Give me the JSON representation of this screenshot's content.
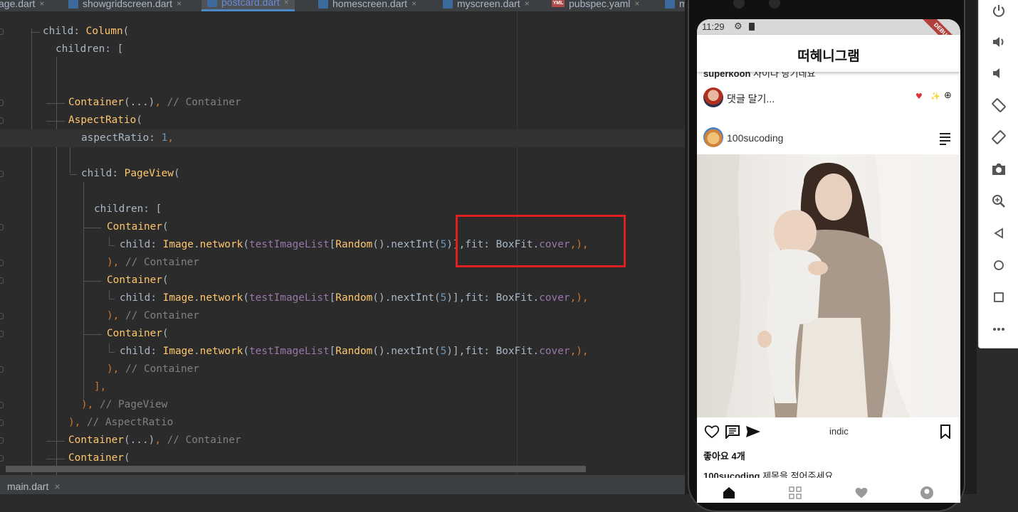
{
  "tabs": [
    {
      "label": "age.dart",
      "icon": "none",
      "active": false
    },
    {
      "label": "showgridscreen.dart",
      "icon": "dart-file-icon",
      "active": false
    },
    {
      "label": "postcard.dart",
      "icon": "dart-file-icon",
      "active": true
    },
    {
      "label": "homescreen.dart",
      "icon": "dart-file-icon",
      "active": false
    },
    {
      "label": "myscreen.dart",
      "icon": "dart-file-icon",
      "active": false
    },
    {
      "label": "pubspec.yaml",
      "icon": "yaml-file-icon",
      "active": false
    },
    {
      "label": "m",
      "icon": "dart-file-icon",
      "active": false
    }
  ],
  "yml_badge": "YML",
  "tab_close": "×",
  "code": {
    "l1": {
      "a": "child: ",
      "b": "Column",
      "c": "("
    },
    "l2": {
      "a": "children: ["
    },
    "l3": {
      "a": "Container",
      "b": "(...)",
      "c": ", ",
      "d": "// Container"
    },
    "l4": {
      "a": "AspectRatio",
      "b": "("
    },
    "l5": {
      "a": "aspectRatio: ",
      "b": "1",
      "c": ","
    },
    "l6": {
      "a": "child: ",
      "b": "PageView",
      "c": "("
    },
    "l7": {
      "a": "children: ["
    },
    "l8": {
      "a": "Container",
      "b": "("
    },
    "img_line": {
      "a": "child: ",
      "b": "Image",
      "c": ".",
      "d": "network",
      "e": "(",
      "f": "testImageList",
      "g": "[",
      "h": "Random",
      "i": "().nextInt(",
      "j": "5",
      "k": ")]",
      "l": ",fit: BoxFit.",
      "m": "cover",
      "n": ",),"
    },
    "close_container": {
      "a": "), ",
      "b": "// Container"
    },
    "l_close_list": {
      "a": "],"
    },
    "l_close_pv": {
      "a": "), ",
      "b": "// PageView"
    },
    "l_close_ar": {
      "a": "), ",
      "b": "// AspectRatio"
    },
    "l_cont2": {
      "a": "Container",
      "b": "(...)",
      "c": ", ",
      "d": "// Container"
    },
    "l_cont3": {
      "a": "Container",
      "b": "("
    }
  },
  "bottom_tab": {
    "label": "main.dart",
    "close": "×"
  },
  "phone": {
    "time": "11:29",
    "gear": "⚙",
    "debug": "DEBUG",
    "app_title": "떠혜니그램",
    "cutoff_user": "superkoon",
    "cutoff_text": " 사이다 당기네요",
    "comment_placeholder": "댓글 달기...",
    "emoji_heart": "♥",
    "emoji_spark": "✨",
    "emoji_plus": "⊕",
    "username": "100sucoding",
    "caption_word": "indic",
    "likes": "좋아요 4개",
    "caption_user": "100sucoding",
    "caption_text": " 제목을 적어주세요"
  }
}
